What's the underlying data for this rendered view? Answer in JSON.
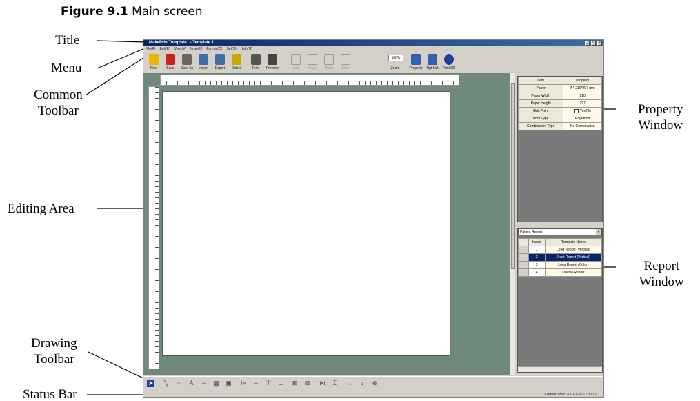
{
  "figure": {
    "number": "Figure 9.1",
    "title": "Main screen"
  },
  "callouts": {
    "title": "Title",
    "menu": "Menu",
    "common_toolbar": [
      "Common",
      "Toolbar"
    ],
    "editing_area": "Editing Area",
    "drawing_toolbar": [
      "Drawing",
      "Toolbar"
    ],
    "status_bar": "Status Bar",
    "property_window": [
      "Property",
      "Window"
    ],
    "report_window": [
      "Report",
      "Window"
    ]
  },
  "app": {
    "window_title": "MakePrintTemplate1 - Template 1",
    "menu": [
      "File(F)",
      "Edit(E)",
      "View(V)",
      "Insert(I)",
      "Format(O)",
      "Set(S)",
      "Help(H)"
    ],
    "toolbar": [
      {
        "label": "New",
        "icon": "new-icon",
        "color": "#e8b400",
        "enabled": true
      },
      {
        "label": "Save",
        "icon": "save-icon",
        "color": "#cc2222",
        "enabled": true
      },
      {
        "label": "Save As",
        "icon": "save-as-icon",
        "color": "#666666",
        "enabled": true
      },
      {
        "label": "Import",
        "icon": "import-icon",
        "color": "#3a6ea5",
        "enabled": true
      },
      {
        "label": "Export",
        "icon": "export-icon",
        "color": "#3a6ea5",
        "enabled": true
      },
      {
        "label": "Delete",
        "icon": "delete-icon",
        "color": "#c9a800",
        "enabled": true
      },
      {
        "label": "Print",
        "icon": "printer-icon",
        "color": "#555555",
        "enabled": true
      },
      {
        "label": "Preview",
        "icon": "magnifier-icon",
        "color": "#444444",
        "enabled": true
      },
      {
        "label": "Cut",
        "icon": "cut-icon",
        "color": "#9a9a9a",
        "enabled": false
      },
      {
        "label": "Copy",
        "icon": "copy-icon",
        "color": "#9a9a9a",
        "enabled": false
      },
      {
        "label": "Paste",
        "icon": "paste-icon",
        "color": "#9a9a9a",
        "enabled": false
      },
      {
        "label": "Delete",
        "icon": "delete-x-icon",
        "color": "#9a9a9a",
        "enabled": false
      },
      {
        "label": "Zoom",
        "icon": "zoom-icon",
        "color": "#444444",
        "enabled": true
      },
      {
        "label": "Property",
        "icon": "property-icon",
        "color": "#2f5fae",
        "enabled": true
      },
      {
        "label": "Rpt List",
        "icon": "report-list-icon",
        "color": "#2f5fae",
        "enabled": true
      },
      {
        "label": "Print OK",
        "icon": "print-ok-icon",
        "color": "#1d3f9b",
        "enabled": true
      }
    ],
    "zoom_value": "100%",
    "property_window": {
      "headers": [
        "Item",
        "Property"
      ],
      "rows": [
        {
          "item": "Paper",
          "value": "A4 210*297 mm"
        },
        {
          "item": "Paper Width",
          "value": "210"
        },
        {
          "item": "Paper Height",
          "value": "297"
        },
        {
          "item": "Grid Point",
          "value": "Yes/No",
          "checkbox": true
        },
        {
          "item": "Print Type",
          "value": "Pagemod"
        },
        {
          "item": "Combination Type",
          "value": "No Combination"
        }
      ]
    },
    "report_window": {
      "dropdown": "Patient Report",
      "headers": [
        "Index",
        "Template Name"
      ],
      "rows": [
        {
          "index": "1",
          "name": "Long Report (Vertical)",
          "selected": false
        },
        {
          "index": "2",
          "name": "Short Report (Vertical)",
          "selected": true
        },
        {
          "index": "3",
          "name": "Long Report (Color)",
          "selected": false
        },
        {
          "index": "4",
          "name": "Double Report",
          "selected": false
        }
      ]
    },
    "drawing_tools": [
      {
        "icon": "pointer-icon",
        "glyph": "➤",
        "active": true
      },
      {
        "icon": "line-icon",
        "glyph": "╲"
      },
      {
        "icon": "ellipse-icon",
        "glyph": "○"
      },
      {
        "icon": "text-icon",
        "glyph": "A"
      },
      {
        "icon": "field-icon",
        "glyph": "≡"
      },
      {
        "icon": "image-icon",
        "glyph": "▦"
      },
      {
        "icon": "picture-icon",
        "glyph": "▣"
      },
      {
        "icon": "align-left-icon",
        "glyph": "⊫"
      },
      {
        "icon": "align-center-icon",
        "glyph": "≡"
      },
      {
        "icon": "align-top-icon",
        "glyph": "⊤"
      },
      {
        "icon": "align-bottom-icon",
        "glyph": "⊥"
      },
      {
        "icon": "group-icon",
        "glyph": "⊞"
      },
      {
        "icon": "ungroup-icon",
        "glyph": "⊟"
      },
      {
        "icon": "same-width-icon",
        "glyph": "⋈"
      },
      {
        "icon": "same-height-icon",
        "glyph": "⌶"
      },
      {
        "icon": "space-h-icon",
        "glyph": "↔"
      },
      {
        "icon": "space-v-icon",
        "glyph": "↕"
      },
      {
        "icon": "center-icon",
        "glyph": "⊕"
      }
    ],
    "status_text": "Current Time:  2007-7-25 17:30:12"
  }
}
